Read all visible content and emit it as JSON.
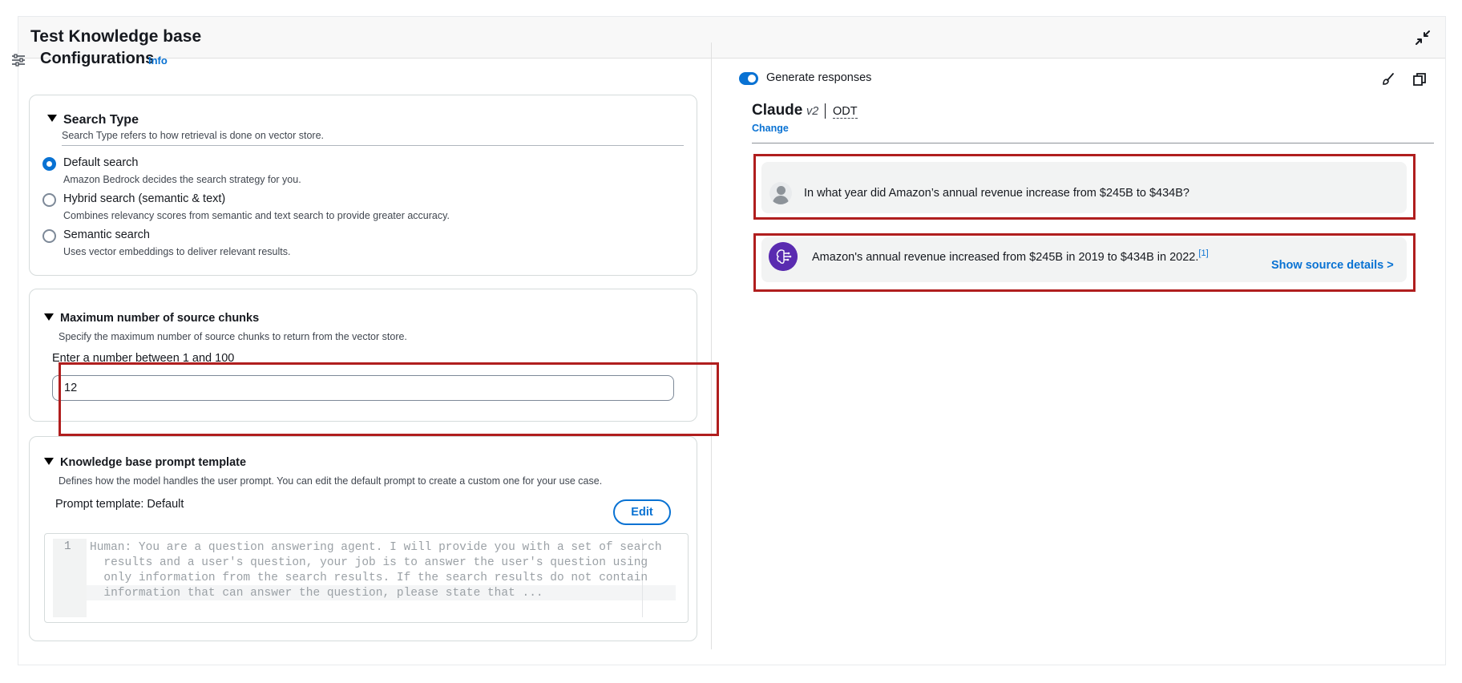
{
  "panel": {
    "title": "Test Knowledge base"
  },
  "config": {
    "title": "Configurations",
    "info_label": "Info"
  },
  "search_type": {
    "title": "Search Type",
    "description": "Search Type refers to how retrieval is done on vector store.",
    "options": [
      {
        "label": "Default search",
        "description": "Amazon Bedrock decides the search strategy for you.",
        "selected": true
      },
      {
        "label": "Hybrid search (semantic & text)",
        "description": "Combines relevancy scores from semantic and text search to provide greater accuracy.",
        "selected": false
      },
      {
        "label": "Semantic search",
        "description": "Uses vector embeddings to deliver relevant results.",
        "selected": false
      }
    ]
  },
  "chunks": {
    "title": "Maximum number of source chunks",
    "description": "Specify the maximum number of source chunks to return from the vector store.",
    "field_label": "Enter a number between 1 and 100",
    "value": "12"
  },
  "prompt_template": {
    "title": "Knowledge base prompt template",
    "description": "Defines how the model handles the user prompt. You can edit the default prompt to create a custom one for your use case.",
    "label": "Prompt template: Default",
    "edit_label": "Edit",
    "line_number": "1",
    "code_lines": [
      "Human: You are a question answering agent. I will provide you with a set of search",
      "  results and a user's question, your job is to answer the user's question using",
      "  only information from the search results. If the search results do not contain",
      "  information that can answer the question, please state that ..."
    ]
  },
  "chat": {
    "generate_label": "Generate responses",
    "generate_enabled": true,
    "model_name": "Claude",
    "model_version": "v2",
    "model_badge": "ODT",
    "change_label": "Change",
    "user_message": "In what year did Amazon’s annual revenue increase from $245B to $434B?",
    "bot_message": "Amazon's annual revenue increased from $245B in 2019 to $434B in 2022.",
    "citation": "[1]",
    "source_link": "Show source details >"
  },
  "colors": {
    "accent": "#0972d3",
    "highlight": "#b01e1e",
    "bot_avatar": "#5a2bb0"
  },
  "icons": {
    "collapse": "collapse-arrows-icon",
    "settings": "sliders-icon",
    "brush": "brush-icon",
    "copy": "copy-icon",
    "user": "user-avatar-icon",
    "bot": "ai-brain-icon"
  }
}
